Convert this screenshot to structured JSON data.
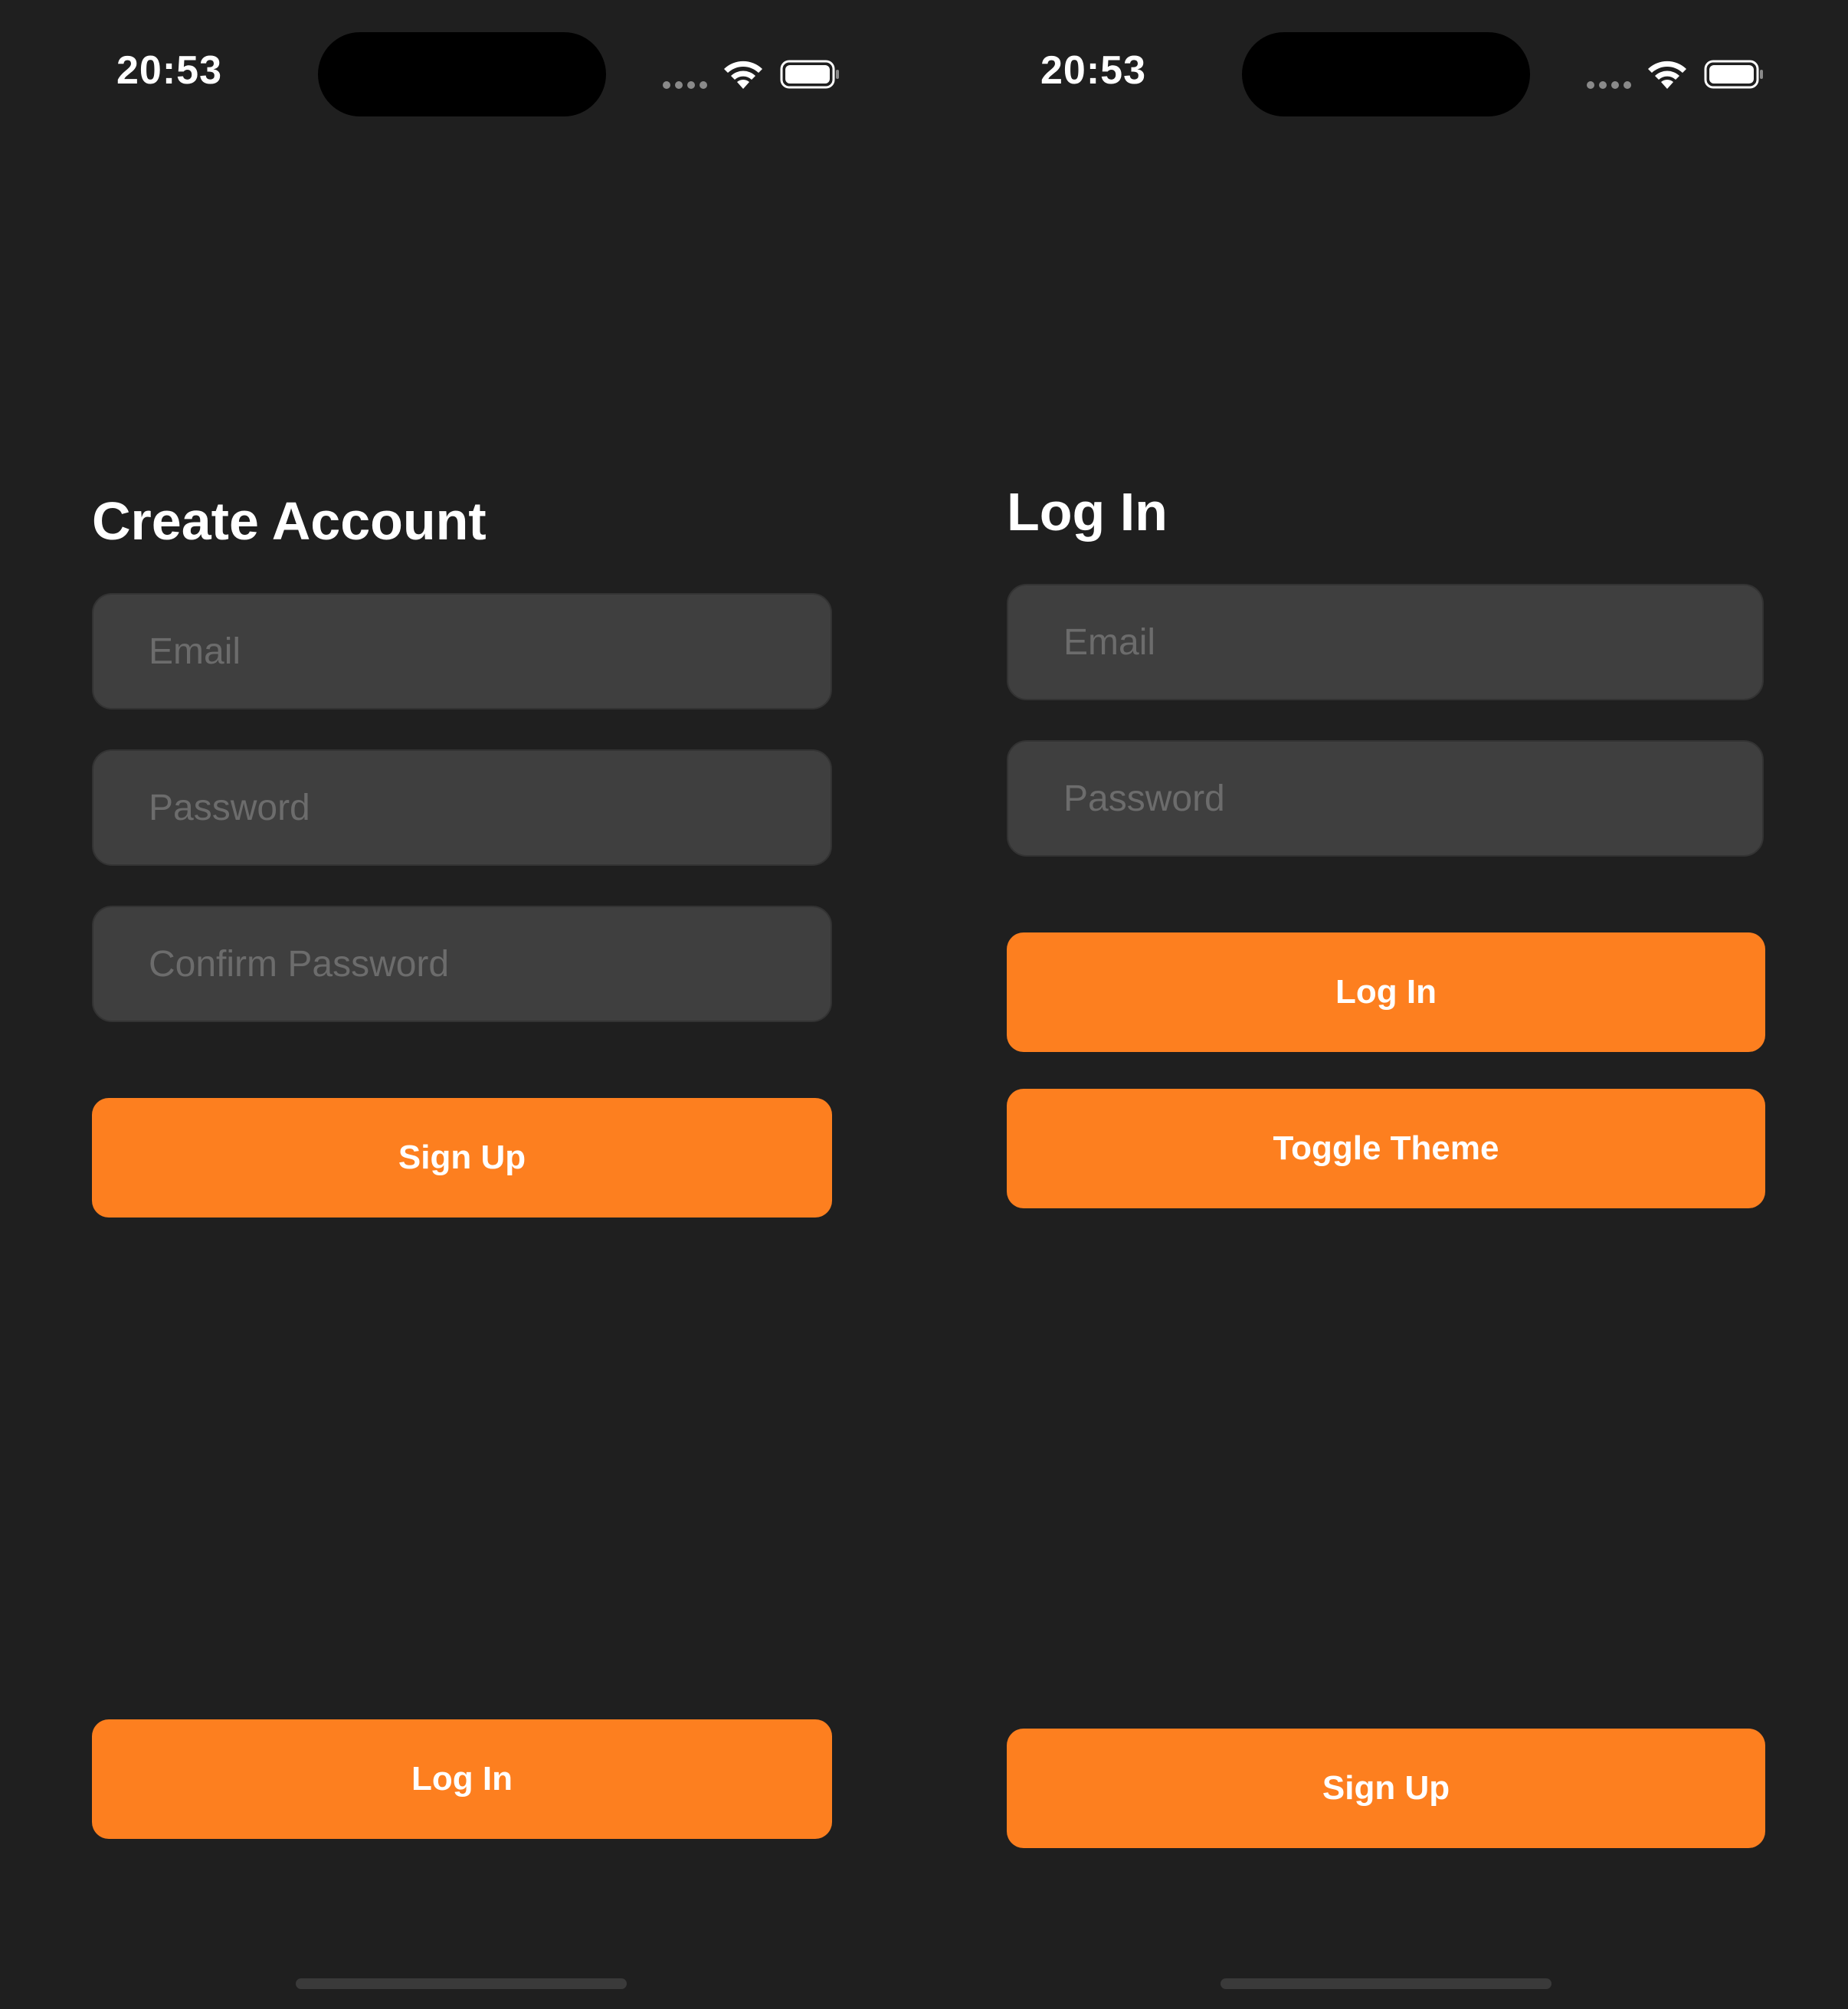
{
  "colors": {
    "background": "#1f1f1f",
    "accent": "#fd7f1f",
    "field_background": "#3f3f3f",
    "placeholder": "#6c6c6c",
    "text": "#ffffff"
  },
  "signup_screen": {
    "status_bar": {
      "time": "20:53",
      "icons": [
        "signal-dots-icon",
        "wifi-icon",
        "battery-icon"
      ]
    },
    "title": "Create Account",
    "email_field": {
      "placeholder": "Email",
      "value": ""
    },
    "password_field": {
      "placeholder": "Password",
      "value": ""
    },
    "confirm_password_field": {
      "placeholder": "Confirm Password",
      "value": ""
    },
    "signup_button": "Sign Up",
    "login_button": "Log In"
  },
  "login_screen": {
    "status_bar": {
      "time": "20:53",
      "icons": [
        "signal-dots-icon",
        "wifi-icon",
        "battery-icon"
      ]
    },
    "title": "Log In",
    "email_field": {
      "placeholder": "Email",
      "value": ""
    },
    "password_field": {
      "placeholder": "Password",
      "value": ""
    },
    "login_button": "Log In",
    "toggle_theme_button": "Toggle Theme",
    "signup_button": "Sign Up"
  }
}
